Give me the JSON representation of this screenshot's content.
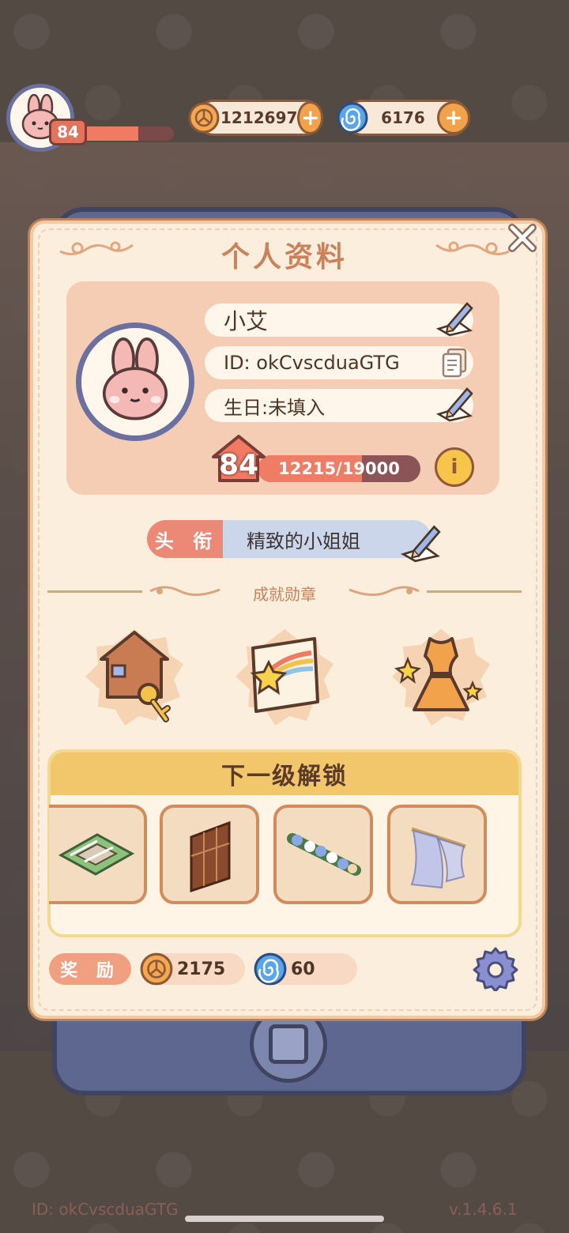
{
  "hud": {
    "player_level": "84",
    "xp_fraction": 0.64,
    "coins": "1212697",
    "gems": "6176",
    "coin_icon": "coin-icon",
    "gem_icon": "swirl-gem-icon"
  },
  "profile": {
    "title": "个人资料",
    "name": "小艾",
    "id_text": "ID: okCvscduaGTG",
    "birthday": "生日:未填入",
    "level": "84",
    "xp_text": "12215/19000",
    "xp_fraction": 0.643
  },
  "honor": {
    "label": "头 衔",
    "value": "精致的小姐姐"
  },
  "achievements": {
    "title": "成就勋章",
    "badges": [
      "house-key-badge",
      "shooting-star-scroll-badge",
      "dress-badge"
    ]
  },
  "unlock": {
    "title": "下一级解锁",
    "items": [
      "garden-path-item",
      "wooden-screen-item",
      "flower-garland-item",
      "lace-curtain-item"
    ]
  },
  "reward": {
    "label": "奖 励",
    "coins": "2175",
    "gems": "60"
  },
  "watermark": {
    "left": "ID: okCvscduaGTG",
    "right": "v.1.4.6.1"
  },
  "colors": {
    "accent": "#ef7c64",
    "card": "#fbeedd",
    "info_box": "#f5cdb5",
    "unlock_header": "#f2c66a"
  }
}
